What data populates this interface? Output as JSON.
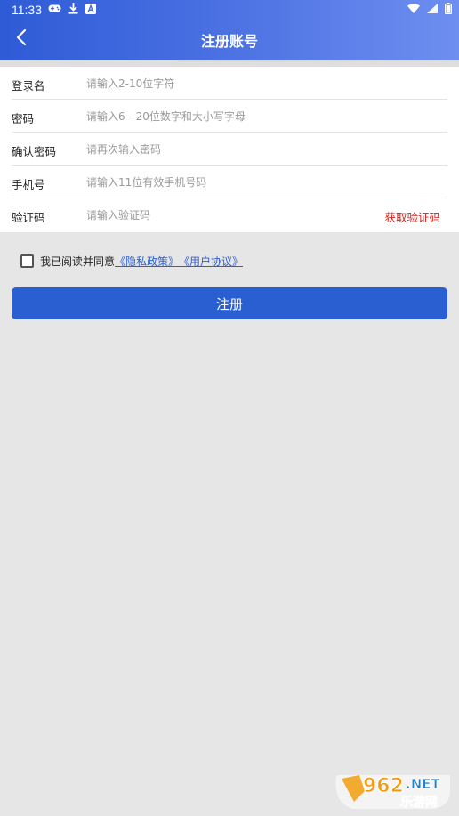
{
  "status_bar": {
    "time": "11:33",
    "left_icons": [
      "gamepad-icon",
      "download-icon",
      "font-a-icon"
    ],
    "right_icons": [
      "wifi-icon",
      "signal-icon",
      "battery-icon"
    ]
  },
  "nav": {
    "title": "注册账号",
    "back_icon": "chevron-left-icon"
  },
  "form": {
    "fields": [
      {
        "label": "登录名",
        "placeholder": "请输入2-10位字符"
      },
      {
        "label": "密码",
        "placeholder": "请输入6 - 20位数字和大小写字母"
      },
      {
        "label": "确认密码",
        "placeholder": "请再次输入密码"
      },
      {
        "label": "手机号",
        "placeholder": "请输入11位有效手机号码"
      },
      {
        "label": "验证码",
        "placeholder": "请输入验证码"
      }
    ],
    "get_code_label": "获取验证码"
  },
  "agreement": {
    "checked": false,
    "text": "我已阅读并同意",
    "privacy_link": "《隐私政策》",
    "user_link": "《用户协议》"
  },
  "submit": {
    "label": "注册"
  },
  "watermark": {
    "brand": "962",
    "suffix": ".NET",
    "sub": "乐游网"
  },
  "colors": {
    "header_start": "#2e5bd6",
    "header_end": "#6e8ff0",
    "button": "#2a5fd2",
    "link": "#2d5fd0",
    "get_code": "#c8231e",
    "background": "#e6e6e6"
  }
}
